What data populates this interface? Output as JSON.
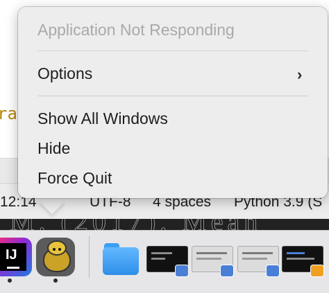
{
  "background": {
    "code_fragment": "ra",
    "doc_fragment": "M. (2017). Mean"
  },
  "status_bar": {
    "time": "12:14",
    "encoding": "UTF-8",
    "indent": "4 spaces",
    "language": "Python 3.9 (S"
  },
  "context_menu": {
    "title": "Application Not Responding",
    "items": [
      {
        "label": "Options",
        "submenu_icon": "chevron-right-icon"
      },
      {
        "label": "Show All Windows"
      },
      {
        "label": "Hide"
      },
      {
        "label": "Force Quit"
      }
    ]
  },
  "dock": {
    "apps": [
      {
        "icon": "intellij-idea-icon",
        "label_text": "IJ",
        "running": true
      },
      {
        "icon": "turtle-app-icon",
        "running": true
      },
      {
        "icon": "folder-icon"
      },
      {
        "icon": "terminal-window-thumbnail"
      },
      {
        "icon": "window-thumbnail"
      },
      {
        "icon": "window-thumbnail"
      },
      {
        "icon": "window-thumbnail"
      }
    ]
  },
  "colors": {
    "menu_bg": "#ececec",
    "disabled_text": "#a9a9a9",
    "folder": "#3c9ef0"
  }
}
